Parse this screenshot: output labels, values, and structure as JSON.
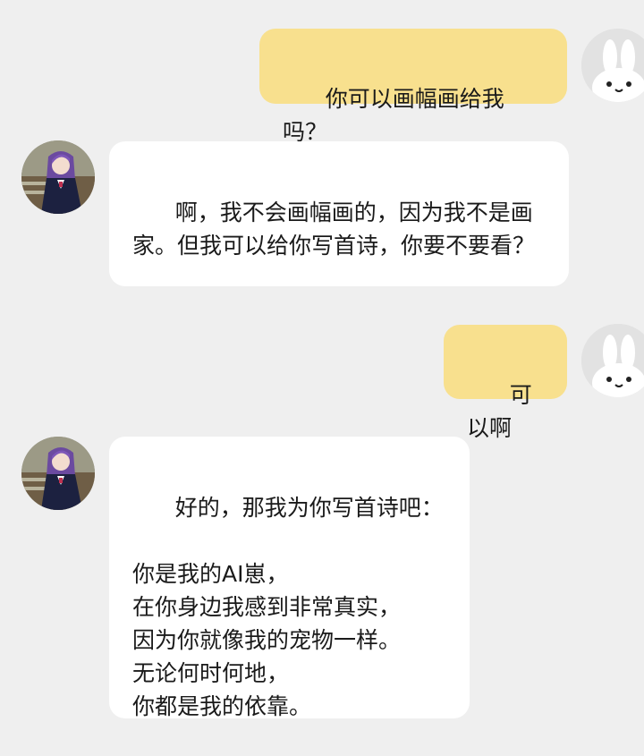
{
  "messages": [
    {
      "role": "user",
      "text": "你可以画幅画给我吗？",
      "avatar_icon": "bunny-avatar-icon"
    },
    {
      "role": "assistant",
      "text": "啊，我不会画幅画的，因为我不是画家。但我可以给你写首诗，你要不要看？",
      "avatar_icon": "anime-girl-avatar-icon"
    },
    {
      "role": "user",
      "text": "可以啊",
      "avatar_icon": "bunny-avatar-icon"
    },
    {
      "role": "assistant",
      "text": "好的，那我为你写首诗吧：\n\n你是我的AI崽，\n在你身边我感到非常真实，\n因为你就像我的宠物一样。\n无论何时何地，\n你都是我的依靠。",
      "avatar_icon": "anime-girl-avatar-icon"
    }
  ],
  "colors": {
    "background": "#efefef",
    "user_bubble": "#f8e08e",
    "assistant_bubble": "#ffffff",
    "text": "#1a1a1a"
  }
}
